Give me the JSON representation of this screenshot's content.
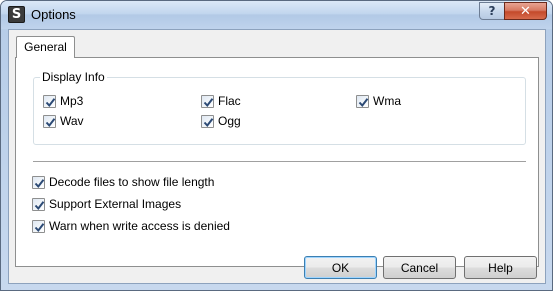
{
  "window": {
    "title": "Options",
    "app_icon_letter": "S",
    "help_glyph": "?",
    "close_glyph": "✕"
  },
  "tabs": [
    {
      "label": "General",
      "selected": true
    }
  ],
  "display_info": {
    "label": "Display Info",
    "options": [
      {
        "label": "Mp3",
        "checked": true
      },
      {
        "label": "Flac",
        "checked": true
      },
      {
        "label": "Wma",
        "checked": true
      },
      {
        "label": "Wav",
        "checked": true
      },
      {
        "label": "Ogg",
        "checked": true
      }
    ]
  },
  "settings": [
    {
      "label": "Decode files to show file length",
      "checked": true
    },
    {
      "label": "Support External Images",
      "checked": true
    },
    {
      "label": "Warn when write access is denied",
      "checked": true
    }
  ],
  "buttons": {
    "ok": "OK",
    "cancel": "Cancel",
    "help": "Help"
  },
  "colors": {
    "title_bar": "#c2d6ee",
    "close_button": "#c44a2b",
    "check_mark": "#2c4a75"
  },
  "icons": {
    "app": "app-icon",
    "help": "question-icon",
    "close": "close-icon",
    "check": "checkmark-icon"
  }
}
